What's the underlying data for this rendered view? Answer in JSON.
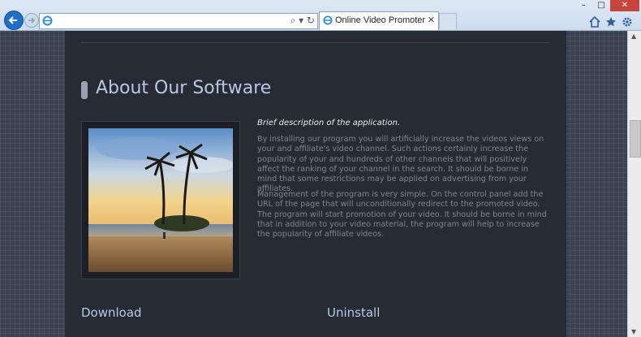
{
  "browser": {
    "tab_title": "Online Video Promoter",
    "tab_close": "✕",
    "address_tools": "⌕ ▾ ↻",
    "window_controls": {
      "minimize": "–",
      "maximize": "□",
      "close": "✕"
    },
    "icons": [
      "back-arrow-icon",
      "forward-arrow-icon",
      "ie-icon",
      "home-icon",
      "star-icon",
      "gear-icon"
    ]
  },
  "page": {
    "heading": "About Our Software",
    "description_title": "Brief description of the application.",
    "description_p1": "By installing our program you will artificially increase the videos views on your and affiliate's video channel. Such actions certainly increase the popularity of your and hundreds of other channels that will positively affect the ranking of your channel in the search. It should be borne in mind that some restrictions may be applied on advertising from your affiliates.",
    "description_p2": "Management of the program is very simple. On the control panel add the URL of the page that will unconditionally redirect to the promoted video. The program will start promotion of your video. It should be borne in mind that in addition to your video material, the program will help to increase the popularity of affiliate videos.",
    "download_title": "Download",
    "uninstall_title": "Uninstall"
  },
  "colors": {
    "page_background": "#272b33",
    "heading": "#b7c7e4",
    "body_text": "#7d8593",
    "browser_accent": "#1f6fc8"
  }
}
